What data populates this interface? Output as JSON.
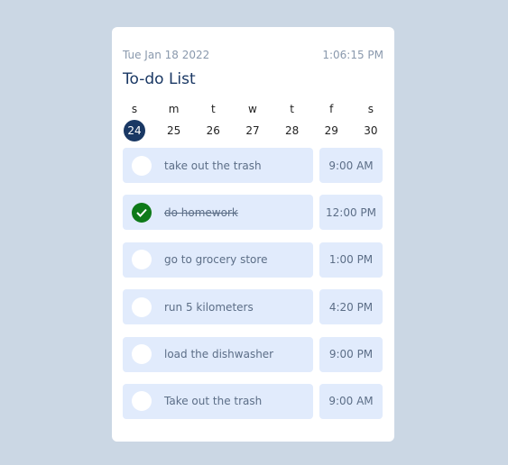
{
  "header": {
    "date": "Tue Jan 18 2022",
    "time": "1:06:15 PM",
    "title": "To-do List"
  },
  "week": [
    {
      "letter": "s",
      "number": "24",
      "selected": true
    },
    {
      "letter": "m",
      "number": "25",
      "selected": false
    },
    {
      "letter": "t",
      "number": "26",
      "selected": false
    },
    {
      "letter": "w",
      "number": "27",
      "selected": false
    },
    {
      "letter": "t",
      "number": "28",
      "selected": false
    },
    {
      "letter": "f",
      "number": "29",
      "selected": false
    },
    {
      "letter": "s",
      "number": "30",
      "selected": false
    }
  ],
  "tasks": [
    {
      "label": "take out the trash",
      "time": "9:00 AM",
      "done": false
    },
    {
      "label": "do homework",
      "time": "12:00 PM",
      "done": true
    },
    {
      "label": "go to grocery store",
      "time": "1:00 PM",
      "done": false
    },
    {
      "label": "run 5 kilometers",
      "time": "4:20 PM",
      "done": false
    },
    {
      "label": "load the dishwasher",
      "time": "9:00 PM",
      "done": false
    },
    {
      "label": "Take out the trash",
      "time": "9:00 AM",
      "done": false
    }
  ],
  "colors": {
    "background": "#cbd7e4",
    "accent": "#1a3864",
    "task_bg": "#e1ebfc",
    "done_check": "#0e7a19"
  },
  "icons": {
    "done": "check-icon"
  }
}
